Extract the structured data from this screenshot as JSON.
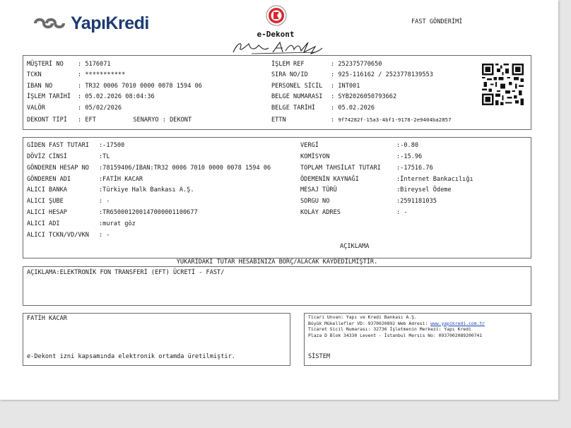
{
  "header": {
    "brand": "YapıKredi",
    "doc_title": "e-Dekont",
    "fast_title": "FAST GÖNDERİMİ"
  },
  "customer": {
    "left": [
      {
        "label": "MÜŞTERİ NO",
        "value": "5176071"
      },
      {
        "label": "TCKN",
        "value": "***********"
      },
      {
        "label": "IBAN NO",
        "value": "TR32 0006 7010 0000 0078 1594 06"
      },
      {
        "label": "İŞLEM TARİHİ",
        "value": "05.02.2026 08:04:36"
      },
      {
        "label": "VALÖR",
        "value": "05/02/2026"
      }
    ],
    "dekont_tipi_label": "DEKONT TİPİ",
    "dekont_tipi_value": "EFT",
    "senaryo_label": "SENARYO",
    "senaryo_value": "DEKONT",
    "right": [
      {
        "label": "İŞLEM REF",
        "value": "252375770650"
      },
      {
        "label": "SIRA NO/ID",
        "value": "925-116162 / 2523778139553"
      },
      {
        "label": "PERSONEL SİCİL",
        "value": "INT001"
      },
      {
        "label": "BELGE NUMARASI",
        "value": "SYB2026050793662"
      },
      {
        "label": "BELGE TARİHİ",
        "value": "05.02.2026"
      },
      {
        "label": "ETTN",
        "value": "9f74282f-15a3-4bf1-9178-2e9404ba2857"
      }
    ]
  },
  "transfer": {
    "left": [
      {
        "label": "GİDEN FAST TUTARI",
        "value": ":-17500"
      },
      {
        "label": "DÖVİZ CİNSİ",
        "value": ":TL"
      },
      {
        "label": "GÖNDEREN HESAP NO",
        "value": ":78159406/IBAN:TR32 0006 7010 0000 0078 1594 06"
      },
      {
        "label": "GÖNDEREN ADI",
        "value": ":FATİH KACAR"
      },
      {
        "label": "ALICI BANKA",
        "value": ":Türkiye Halk Bankası A.Ş."
      },
      {
        "label": "ALICI ŞUBE",
        "value": ": -"
      },
      {
        "label": "ALICI HESAP",
        "value": ":TR650001200147000001100677"
      },
      {
        "label": "ALICI ADI",
        "value": ":murat göz"
      },
      {
        "label": "ALICI TCKN/VD/VKN",
        "value": ": -"
      }
    ],
    "right": [
      {
        "label": "VERGİ",
        "value": ":-0.80"
      },
      {
        "label": "KOMİSYON",
        "value": ":-15.96"
      },
      {
        "label": "TOPLAM TAHSİLAT TUTARI",
        "value": ":-17516.76"
      },
      {
        "label": "ÖDEMENİN KAYNAĞI",
        "value": ":İnternet Bankacılığı"
      },
      {
        "label": "MESAJ TÜRÜ",
        "value": ":Bireysel Ödeme"
      },
      {
        "label": "SORGU NO",
        "value": ":2591181035"
      },
      {
        "label": "KOLAY ADRES",
        "value": ": -"
      }
    ],
    "aciklama_heading": "AÇIKLAMA"
  },
  "notice": "YUKARIDAKİ TUTAR HESABINIZA BORÇ/ALACAK KAYDEDİLMİŞTİR.",
  "description": "AÇIKLAMA:ELEKTRONİK FON TRANSFERİ (EFT) ÜCRETİ - FAST/",
  "footer": {
    "owner": "FATİH KACAR",
    "electronic_note": "e-Dekont izni kapsamında elektronik ortamda üretilmiştir.",
    "bank_info_1": "Ticari Unvan: Yapı ve Kredi Bankası A.Ş.",
    "bank_info_2_prefix": "Büyük Mükellefler VD: 9370020892 Web Adresi: ",
    "bank_info_2_link": "www.yapikredi.com.tr",
    "bank_info_3": "Ticaret Sicil Numarası: 32736 İşletmenin Merkezi: Yapı Kredi",
    "bank_info_4": "Plaza D Blok 34330 Levent - İstanbul Mersis No: 0937002089200741",
    "system": "SİSTEM"
  }
}
